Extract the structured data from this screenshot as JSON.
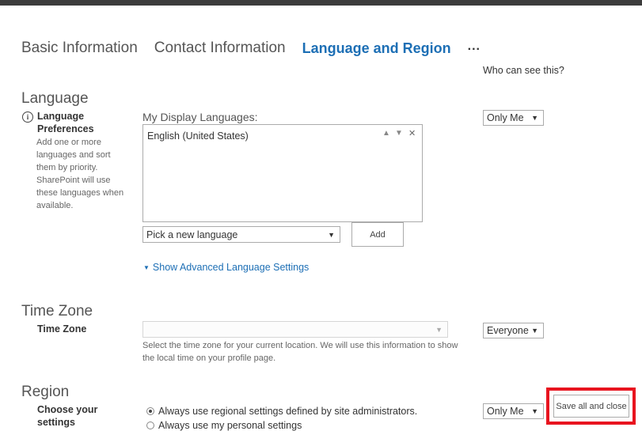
{
  "tabs": [
    {
      "label": "Basic Information"
    },
    {
      "label": "Contact Information"
    },
    {
      "label": "Language and Region"
    }
  ],
  "tabs_more": "...",
  "who_can_see": "Who can see this?",
  "language": {
    "section_title": "Language",
    "label": "Language Preferences",
    "help": "Add one or more languages and sort them by priority. SharePoint will use these languages when available.",
    "display_label": "My Display Languages:",
    "items": [
      "English (United States)"
    ],
    "picker_value": "Pick a new language",
    "add_label": "Add",
    "advanced_link": "Show Advanced Language Settings",
    "privacy": "Only Me"
  },
  "time_zone": {
    "section_title": "Time Zone",
    "label": "Time Zone",
    "value": "",
    "help": "Select the time zone for your current location. We will use this information to show the local time on your profile page.",
    "privacy": "Everyone"
  },
  "region": {
    "section_title": "Region",
    "label": "Choose your settings",
    "option_admin": "Always use regional settings defined by site administrators.",
    "option_personal": "Always use my personal settings",
    "privacy": "Only Me"
  },
  "save_label": "Save all and close",
  "colors": {
    "accent": "#1d6fb5",
    "highlight": "#e8141f"
  }
}
